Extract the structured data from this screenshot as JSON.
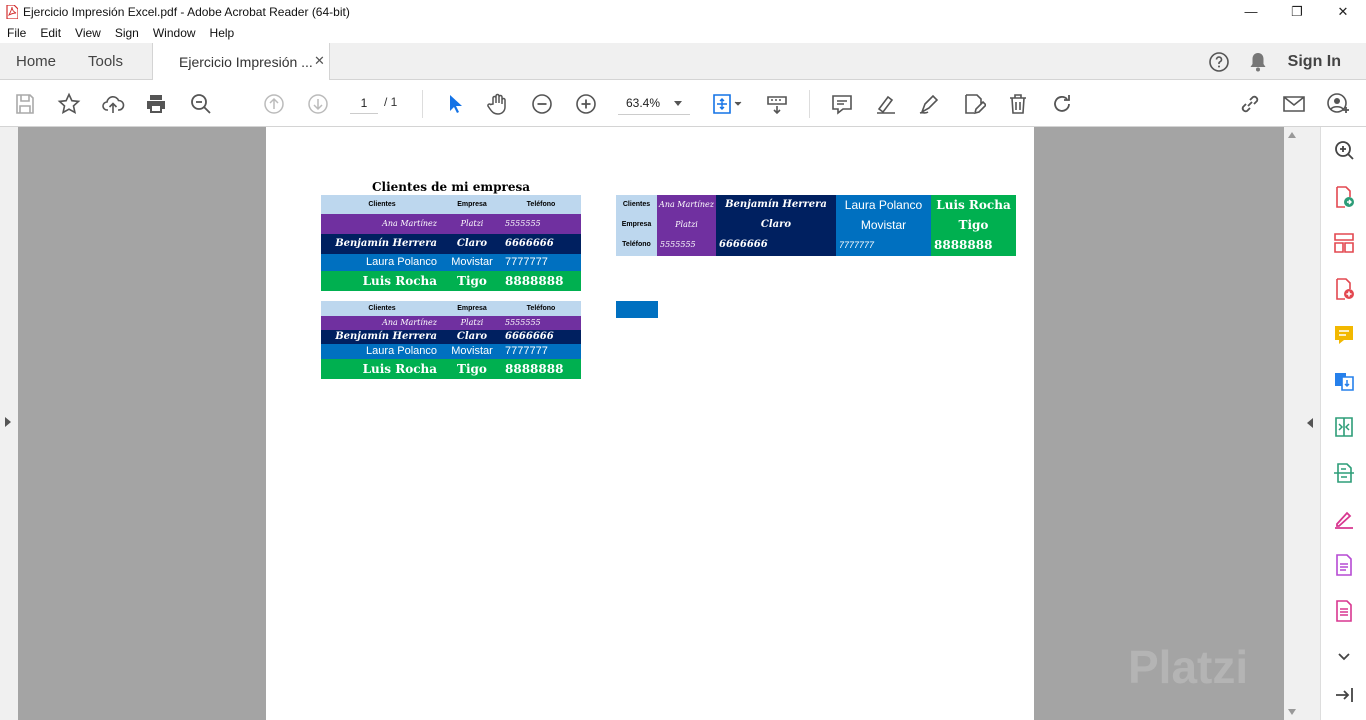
{
  "window": {
    "title": "Ejercicio Impresión Excel.pdf - Adobe Acrobat Reader (64-bit)",
    "minimize": "—",
    "restore": "❐",
    "close": "✕"
  },
  "menu": [
    "File",
    "Edit",
    "View",
    "Sign",
    "Window",
    "Help"
  ],
  "tabs": {
    "home": "Home",
    "tools": "Tools",
    "document": "Ejercicio Impresión ...",
    "close": "✕"
  },
  "header": {
    "sign_in": "Sign In"
  },
  "toolbar": {
    "page_current": "1",
    "page_total": "/ 1",
    "zoom": "63.4%"
  },
  "document": {
    "sheet_title": "Clientes de mi empresa",
    "headers": [
      "Clientes",
      "Empresa",
      "Teléfono"
    ],
    "rows": [
      {
        "cliente": "Ana Martínez",
        "empresa": "Platzi",
        "telefono": "5555555"
      },
      {
        "cliente": "Benjamín Herrera",
        "empresa": "Claro",
        "telefono": "6666666"
      },
      {
        "cliente": "Laura Polanco",
        "empresa": "Movistar",
        "telefono": "7777777"
      },
      {
        "cliente": "Luis Rocha",
        "empresa": "Tigo",
        "telefono": "8888888"
      }
    ]
  },
  "watermark": "Platzi",
  "colors": {
    "purple": "#7030a0",
    "navy": "#002060",
    "blue": "#0070c0",
    "green": "#00b050",
    "header": "#bdd7ee"
  }
}
